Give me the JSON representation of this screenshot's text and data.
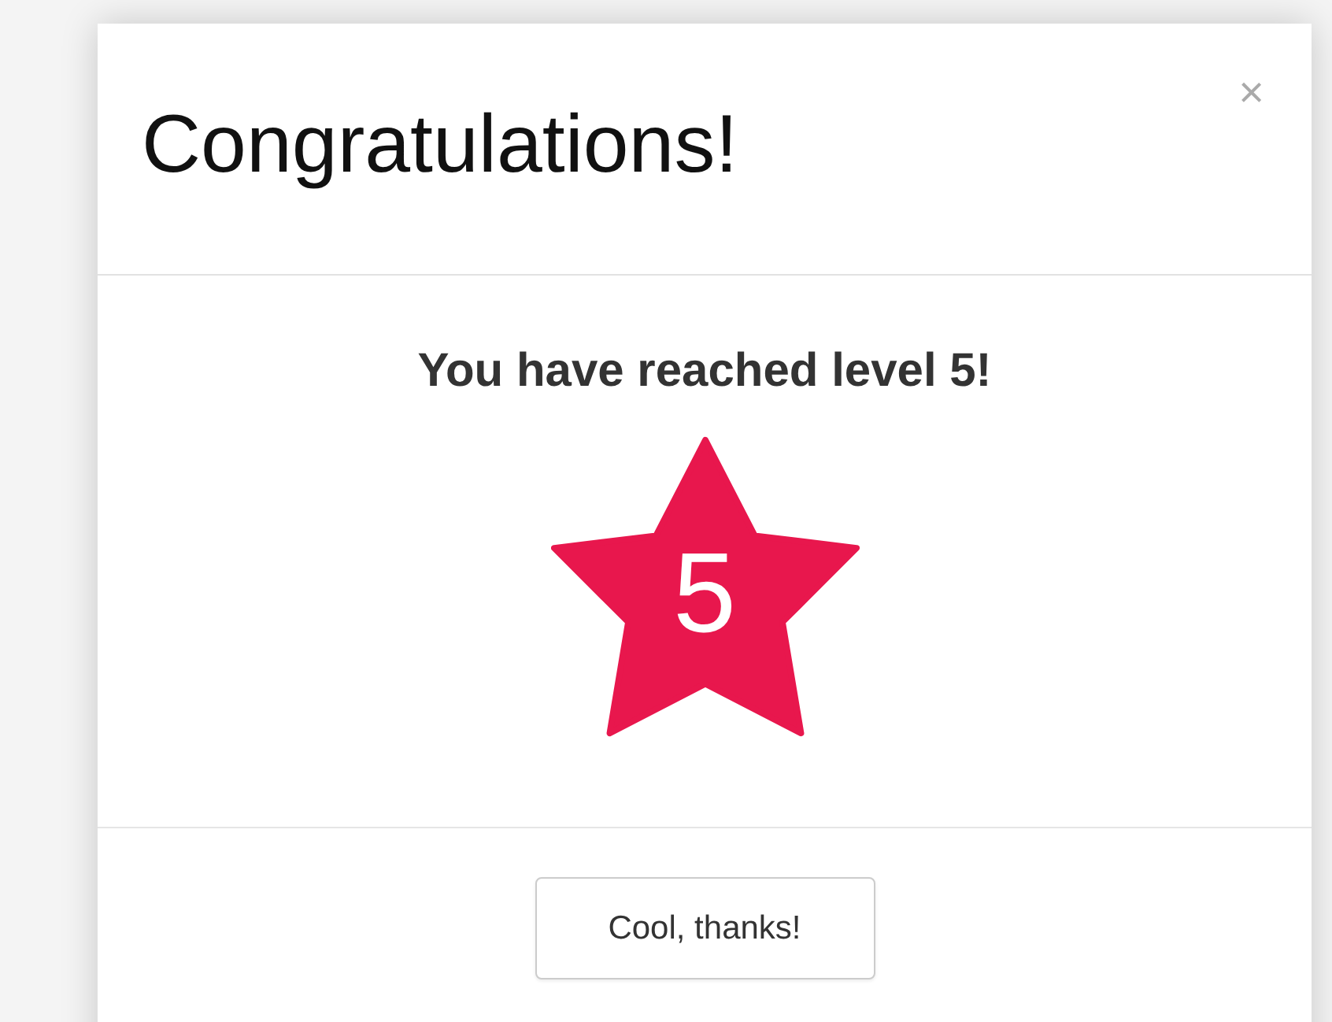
{
  "modal": {
    "title": "Congratulations!",
    "close": "×",
    "message": "You have reached level 5!",
    "badge": {
      "number": "5",
      "color": "#e8174d"
    },
    "buttons": [
      "Cool, thanks!"
    ]
  }
}
